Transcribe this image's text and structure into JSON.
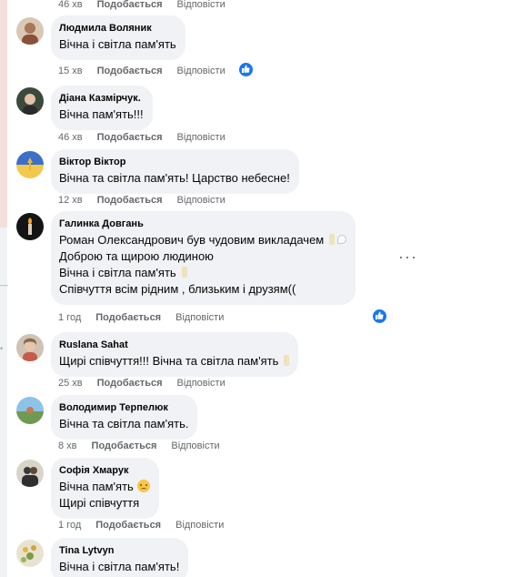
{
  "actions": {
    "like": "Подобається",
    "reply": "Відповісти"
  },
  "more_menu": "···",
  "top_row": {
    "time": "46 хв"
  },
  "comments": [
    {
      "name": "Людмила Воляник",
      "lines": [
        "Вічна і світла пам'ять"
      ],
      "time": "15 хв",
      "reaction": "like"
    },
    {
      "name": "Діана Казмірчук.",
      "lines": [
        "Вічна пам'ять!!!"
      ],
      "time": "46 хв"
    },
    {
      "name": "Віктор Віктор",
      "lines": [
        "Вічна та світла пам'ять! Царство небесне!"
      ],
      "time": "12 хв"
    },
    {
      "name": "Галинка Довгань",
      "lines": [
        "Роман Олександрович був чудовим викладачем",
        "Доброю та щирою людиною",
        "Вічна і світла пам'ять",
        "Співчуття всім рідним , близьким і друзям(("
      ],
      "time": "1 год",
      "reaction": "like"
    },
    {
      "name": "Ruslana Sahat",
      "lines": [
        "Щирі співчуття!!! Вічна та світла пам'ять"
      ],
      "time": "25 хв"
    },
    {
      "name": "Володимир Терпелюк",
      "lines": [
        "Вічна та світла пам'ять."
      ],
      "time": "8 хв"
    },
    {
      "name": "Софія Хмарук",
      "lines": [
        "Вічна пам'ять",
        "Щирі співчуття"
      ],
      "time": "1 год"
    },
    {
      "name": "Tina Lytvyn",
      "lines": [
        "Вічна і світла пам'ять!"
      ],
      "time": ""
    }
  ],
  "icons": {
    "like_reaction": "thumbs-up-icon",
    "candle": "candle-emoji-icon",
    "tear": "tear-emoji-icon",
    "sad": "sad-face-emoji-icon",
    "more": "more-options-icon"
  },
  "colors": {
    "like_blue": "#1877f2",
    "bubble": "#f0f2f5",
    "meta_gray": "#65676b"
  }
}
